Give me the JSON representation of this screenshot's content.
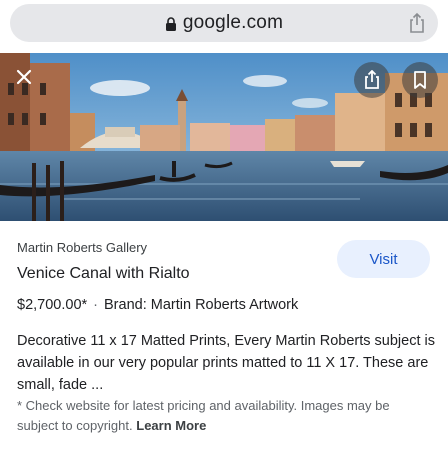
{
  "browser": {
    "url": "google.com"
  },
  "result": {
    "source": "Martin Roberts Gallery",
    "title": "Venice Canal with Rialto",
    "visit_label": "Visit",
    "price": "$2,700.00*",
    "separator": "·",
    "brand": "Brand: Martin Roberts Artwork",
    "description": "Decorative 11 x 17 Matted Prints, Every Martin Roberts subject is available in our very popular prints matted to 11 X 17. These are small, fade ...",
    "disclaimer": "* Check website for latest pricing and availability. Images may be subject to copyright.",
    "learn_more": "Learn More"
  },
  "icons": {
    "lock": "lock-icon",
    "share": "share-icon",
    "close": "close-icon",
    "bookmark": "bookmark-icon"
  },
  "colors": {
    "url_bar": "#e6e7ea",
    "visit_bg": "#e8f0fe",
    "visit_text": "#1a56c8"
  }
}
